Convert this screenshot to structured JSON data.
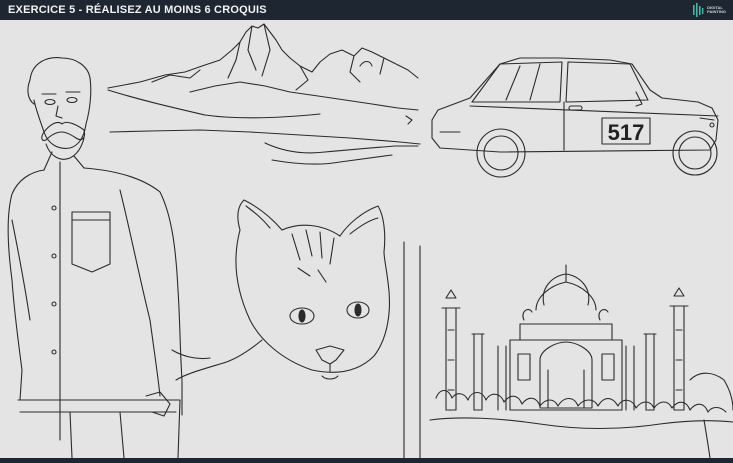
{
  "header": {
    "title": "EXERCICE 5 - RÉALISEZ AU MOINS 6 CROQUIS",
    "logo_line1": "DIGITAL",
    "logo_line2": "PAINTING",
    "logo_icon": "brush-bars-icon"
  },
  "canvas": {
    "car_number": "517"
  },
  "colors": {
    "header_bg": "#1d2631",
    "canvas_bg": "#e4e4e4",
    "ink": "#2b2b2b",
    "logo_accent": "#3fb8a6"
  }
}
